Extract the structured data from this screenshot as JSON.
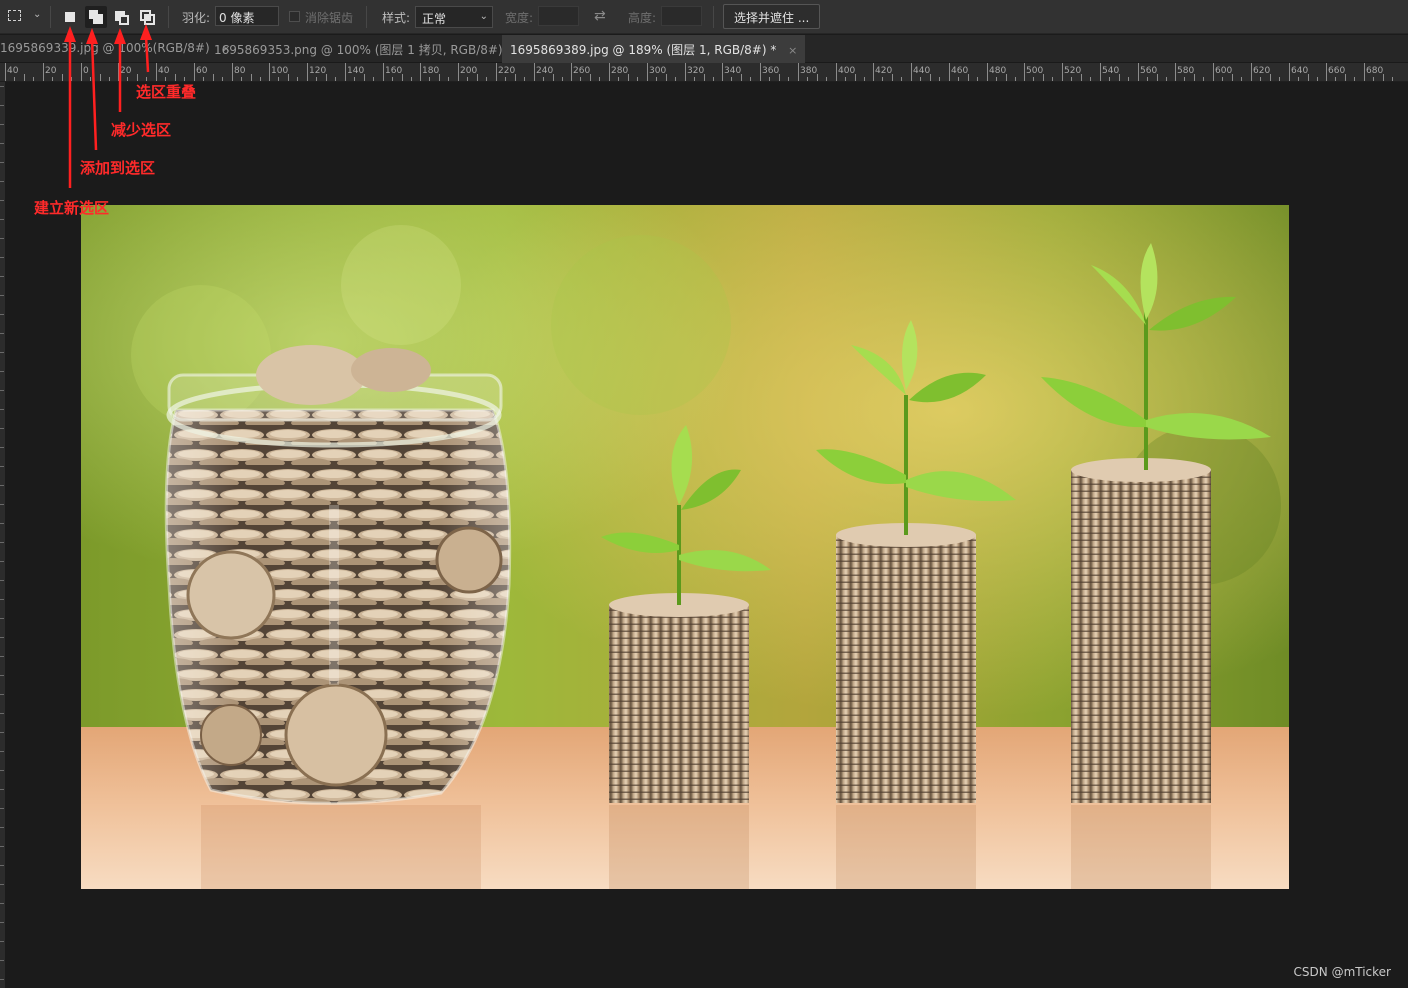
{
  "options_bar": {
    "tool_caret": "⌄",
    "feather_label": "羽化:",
    "feather_value": "0 像素",
    "antialias_label": "消除锯齿",
    "style_label": "样式:",
    "style_value": "正常",
    "width_label": "宽度:",
    "height_label": "高度:",
    "select_and_mask": "选择并遮住 ..."
  },
  "tabs": [
    {
      "label": "1695869339.jpg @ 100%(RGB/8#)",
      "close": "×"
    },
    {
      "label": "1695869353.png @ 100% (图层 1 拷贝, RGB/8#) *",
      "close": "×"
    },
    {
      "label": "1695869389.jpg @ 189% (图层 1, RGB/8#) *",
      "close": "×"
    }
  ],
  "ruler": {
    "labels": [
      "40",
      "20",
      "0",
      "20",
      "40",
      "60",
      "80",
      "100",
      "120",
      "140",
      "160",
      "180",
      "200",
      "220",
      "240",
      "260",
      "280",
      "300",
      "320",
      "340",
      "360",
      "380",
      "400",
      "420",
      "440",
      "460",
      "480",
      "500",
      "520",
      "540",
      "560",
      "580",
      "600",
      "620",
      "640",
      "660",
      "680"
    ]
  },
  "annotations": {
    "new_selection": "建立新选区",
    "add_to_selection": "添加到选区",
    "subtract_selection": "减少选区",
    "intersect_selection": "选区重叠"
  },
  "watermark": "CSDN @mTicker",
  "colors": {
    "annotation": "#ff2020",
    "ui_background": "#323232",
    "canvas_background": "#1b1b1b"
  }
}
